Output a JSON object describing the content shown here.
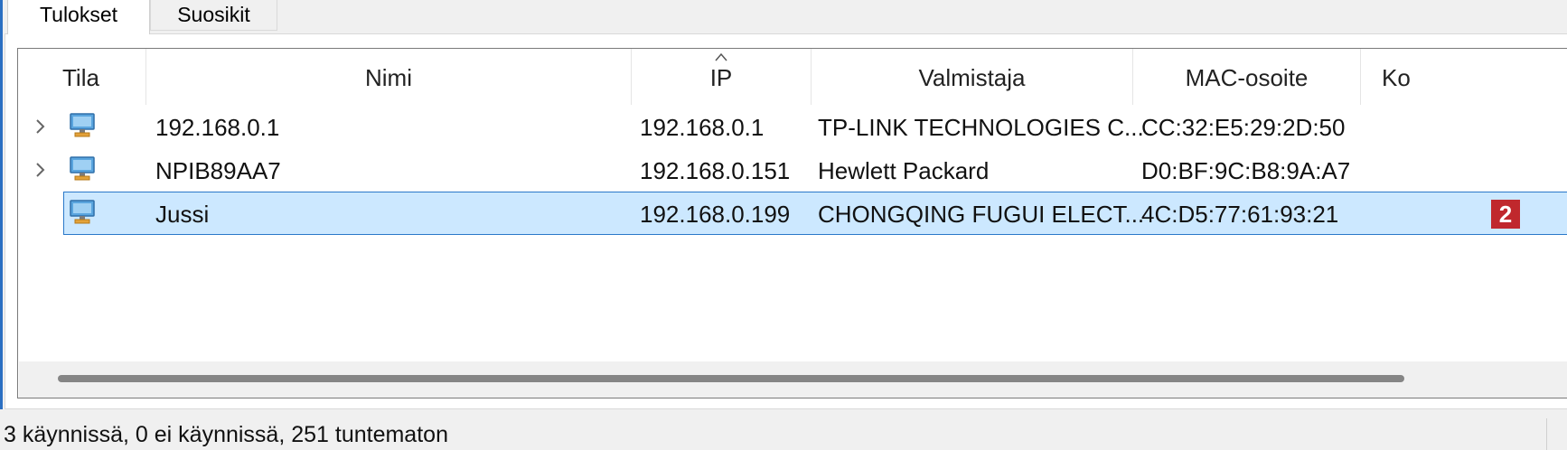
{
  "tabs": [
    {
      "label": "Tulokset",
      "active": true
    },
    {
      "label": "Suosikit",
      "active": false
    }
  ],
  "table": {
    "columns": [
      "Tila",
      "Nimi",
      "IP",
      "Valmistaja",
      "MAC-osoite",
      "Ko"
    ],
    "sorted_column": "IP",
    "rows": [
      {
        "name": "192.168.0.1",
        "ip": "192.168.0.1",
        "vendor": "TP-LINK TECHNOLOGIES C...",
        "mac": "CC:32:E5:29:2D:50",
        "expandable": true,
        "selected": false,
        "icon": "computer-icon"
      },
      {
        "name": "NPIB89AA7",
        "ip": "192.168.0.151",
        "vendor": "Hewlett Packard",
        "mac": "D0:BF:9C:B8:9A:A7",
        "expandable": true,
        "selected": false,
        "icon": "computer-icon"
      },
      {
        "name": "Jussi",
        "ip": "192.168.0.199",
        "vendor": "CHONGQING FUGUI ELECT...",
        "mac": "4C:D5:77:61:93:21",
        "expandable": false,
        "selected": true,
        "icon": "computer-icon"
      }
    ]
  },
  "badge": {
    "label": "2",
    "color": "#c0282d"
  },
  "status": {
    "text": "3 käynnissä, 0 ei käynnissä, 251 tuntematon"
  },
  "colors": {
    "selection": "#cce8ff",
    "selection_border": "#2a78c9",
    "accent": "#2b6fc2"
  }
}
